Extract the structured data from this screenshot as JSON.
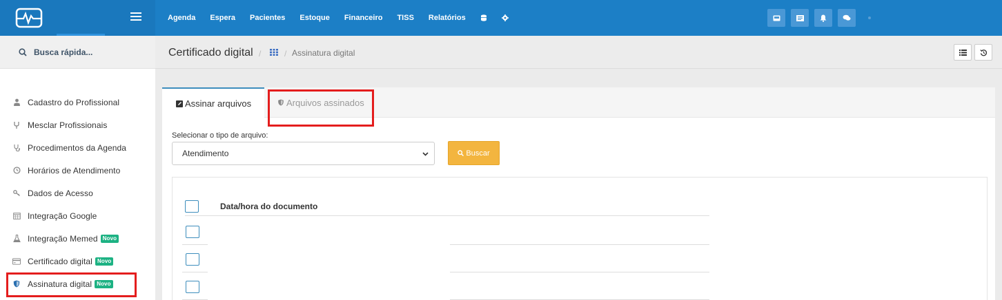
{
  "topbar": {
    "logo_icon": "heartbeat-monitor-icon",
    "menu_icon": "hamburger-icon",
    "nav": [
      "Agenda",
      "Espera",
      "Pacientes",
      "Estoque",
      "Financeiro",
      "TISS",
      "Relatórios"
    ],
    "nav_icons": [
      "database-icon",
      "gear-icon"
    ],
    "actions": [
      "inbox-icon",
      "list-icon",
      "bell-icon",
      "chat-icon"
    ],
    "colors": {
      "bar": "#1c7fc6",
      "brand": "#1a78bd"
    }
  },
  "sidebar": {
    "search_label": "Busca rápida...",
    "items": [
      {
        "label": "Cadastro do Profissional",
        "icon": "user-icon",
        "badge": ""
      },
      {
        "label": "Mesclar Profissionais",
        "icon": "merge-icon",
        "badge": ""
      },
      {
        "label": "Procedimentos da Agenda",
        "icon": "stethoscope-icon",
        "badge": ""
      },
      {
        "label": "Horários de Atendimento",
        "icon": "clock-icon",
        "badge": ""
      },
      {
        "label": "Dados de Acesso",
        "icon": "key-icon",
        "badge": ""
      },
      {
        "label": "Integração Google",
        "icon": "calendar-icon",
        "badge": ""
      },
      {
        "label": "Integração Memed",
        "icon": "flask-icon",
        "badge": "Novo"
      },
      {
        "label": "Certificado digital",
        "icon": "credit-card-icon",
        "badge": "Novo"
      },
      {
        "label": "Assinatura digital",
        "icon": "shield-icon",
        "badge": "Novo"
      }
    ],
    "badge_color": "#1db283"
  },
  "breadcrumb": {
    "title": "Certificado digital",
    "separator": "/",
    "current": "Assinatura digital"
  },
  "tabs": {
    "active": "Assinar arquivos",
    "inactive": "Arquivos assinados"
  },
  "form": {
    "label": "Selecionar o tipo de arquivo:",
    "selected": "Atendimento",
    "button": "Buscar",
    "button_color": "#f3b53f"
  },
  "table": {
    "header": "Data/hora do documento",
    "rows": 3
  },
  "highlight_color": "#e41d1d"
}
